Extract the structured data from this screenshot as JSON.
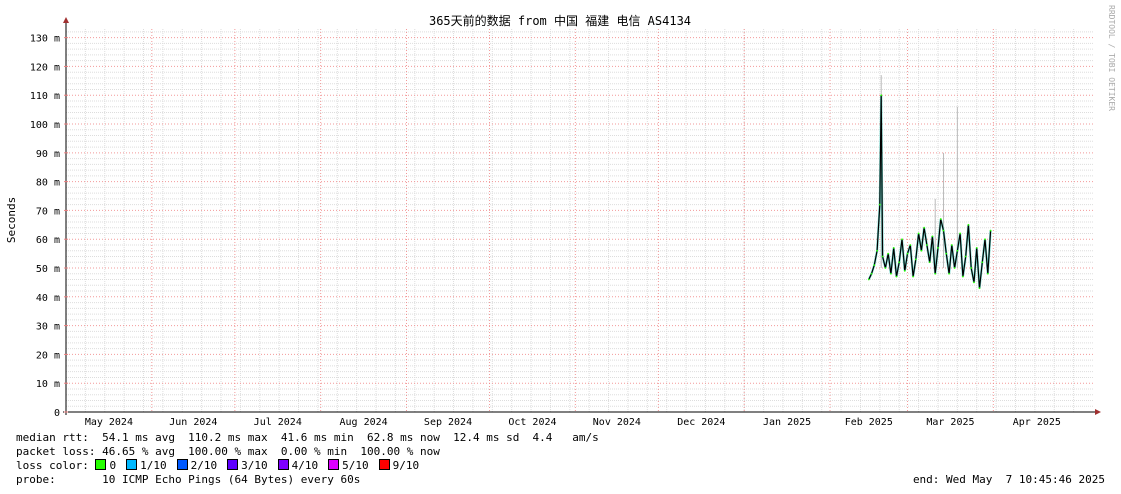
{
  "chart_data": {
    "type": "line",
    "title": "365天前的数据 from 中国 福建 电信 AS4134",
    "ylabel": "Seconds",
    "watermark": "RRDTOOL / TOBI OETIKER",
    "ylim": [
      0,
      133
    ],
    "y_ticks": [
      {
        "value": 0,
        "label": "0"
      },
      {
        "value": 10,
        "label": "10 m"
      },
      {
        "value": 20,
        "label": "20 m"
      },
      {
        "value": 30,
        "label": "30 m"
      },
      {
        "value": 40,
        "label": "40 m"
      },
      {
        "value": 50,
        "label": "50 m"
      },
      {
        "value": 60,
        "label": "60 m"
      },
      {
        "value": 70,
        "label": "70 m"
      },
      {
        "value": 80,
        "label": "80 m"
      },
      {
        "value": 90,
        "label": "90 m"
      },
      {
        "value": 100,
        "label": "100 m"
      },
      {
        "value": 110,
        "label": "110 m"
      },
      {
        "value": 120,
        "label": "120 m"
      },
      {
        "value": 130,
        "label": "130 m"
      }
    ],
    "x_range": [
      "2024-05-07",
      "2025-05-07"
    ],
    "x_ticks": [
      {
        "date": "2024-05-01",
        "label": "May 2024"
      },
      {
        "date": "2024-06-01",
        "label": "Jun 2024"
      },
      {
        "date": "2024-07-01",
        "label": "Jul 2024"
      },
      {
        "date": "2024-08-01",
        "label": "Aug 2024"
      },
      {
        "date": "2024-09-01",
        "label": "Sep 2024"
      },
      {
        "date": "2024-10-01",
        "label": "Oct 2024"
      },
      {
        "date": "2024-11-01",
        "label": "Nov 2024"
      },
      {
        "date": "2024-12-01",
        "label": "Dec 2024"
      },
      {
        "date": "2025-01-01",
        "label": "Jan 2025"
      },
      {
        "date": "2025-02-01",
        "label": "Feb 2025"
      },
      {
        "date": "2025-03-01",
        "label": "Mar 2025"
      },
      {
        "date": "2025-04-01",
        "label": "Apr 2025"
      }
    ],
    "series": [
      {
        "name": "median rtt",
        "color": "#000000",
        "points": [
          [
            "2025-02-15",
            46
          ],
          [
            "2025-02-16",
            48
          ],
          [
            "2025-02-17",
            51
          ],
          [
            "2025-02-18",
            56
          ],
          [
            "2025-02-19",
            72
          ],
          [
            "2025-02-19T12:00",
            110
          ],
          [
            "2025-02-20",
            54
          ],
          [
            "2025-02-21",
            50
          ],
          [
            "2025-02-22",
            55
          ],
          [
            "2025-02-23",
            48
          ],
          [
            "2025-02-24",
            57
          ],
          [
            "2025-02-25",
            47
          ],
          [
            "2025-02-26",
            52
          ],
          [
            "2025-02-27",
            60
          ],
          [
            "2025-02-28",
            49
          ],
          [
            "2025-03-01",
            55
          ],
          [
            "2025-03-02",
            58
          ],
          [
            "2025-03-03",
            47
          ],
          [
            "2025-03-04",
            53
          ],
          [
            "2025-03-05",
            62
          ],
          [
            "2025-03-06",
            56
          ],
          [
            "2025-03-07",
            64
          ],
          [
            "2025-03-08",
            58
          ],
          [
            "2025-03-09",
            52
          ],
          [
            "2025-03-10",
            61
          ],
          [
            "2025-03-11",
            48
          ],
          [
            "2025-03-12",
            57
          ],
          [
            "2025-03-13",
            67
          ],
          [
            "2025-03-14",
            63
          ],
          [
            "2025-03-15",
            55
          ],
          [
            "2025-03-16",
            48
          ],
          [
            "2025-03-17",
            58
          ],
          [
            "2025-03-18",
            50
          ],
          [
            "2025-03-19",
            56
          ],
          [
            "2025-03-20",
            62
          ],
          [
            "2025-03-21",
            47
          ],
          [
            "2025-03-22",
            54
          ],
          [
            "2025-03-23",
            65
          ],
          [
            "2025-03-24",
            50
          ],
          [
            "2025-03-25",
            45
          ],
          [
            "2025-03-26",
            57
          ],
          [
            "2025-03-27",
            43
          ],
          [
            "2025-03-28",
            52
          ],
          [
            "2025-03-29",
            60
          ],
          [
            "2025-03-30",
            48
          ],
          [
            "2025-03-31",
            63
          ]
        ]
      }
    ],
    "smoke_spikes": [
      {
        "date": "2025-02-19T12:00",
        "value": 117
      },
      {
        "date": "2025-03-14",
        "value": 90
      },
      {
        "date": "2025-03-19",
        "value": 106
      },
      {
        "date": "2025-03-11",
        "value": 74
      }
    ],
    "grid": true
  },
  "legend": {
    "rtt_line": "median rtt:  54.1 ms avg  110.2 ms max  41.6 ms min  62.8 ms now  12.4 ms sd  4.4   am/s",
    "loss_line": "packet loss: 46.65 % avg  100.00 % max  0.00 % min  100.00 % now",
    "loss_color_label": "loss color:",
    "loss_colors": [
      {
        "label": "0",
        "color": "#26ff00"
      },
      {
        "label": "1/10",
        "color": "#00b8ff"
      },
      {
        "label": "2/10",
        "color": "#0059ff"
      },
      {
        "label": "3/10",
        "color": "#5e00ff"
      },
      {
        "label": "4/10",
        "color": "#7e00ff"
      },
      {
        "label": "5/10",
        "color": "#dd00ff"
      },
      {
        "label": "9/10",
        "color": "#ff0000"
      }
    ],
    "probe_line": "probe:       10 ICMP Echo Pings (64 Bytes) every 60s",
    "end_line": "end: Wed May  7 10:45:46 2025"
  }
}
